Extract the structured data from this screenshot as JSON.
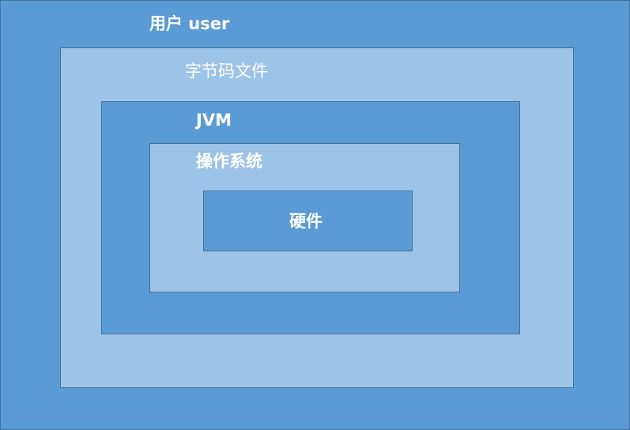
{
  "layers": {
    "user": {
      "label": "用户 user"
    },
    "bytecode": {
      "label": "字节码文件"
    },
    "jvm": {
      "label": "JVM"
    },
    "os": {
      "label": "操作系统"
    },
    "hardware": {
      "label": "硬件"
    }
  },
  "colors": {
    "dark_fill": "#5b9bd5",
    "light_fill": "#9dc3e6",
    "border": "#41719c",
    "text": "#ffffff"
  }
}
